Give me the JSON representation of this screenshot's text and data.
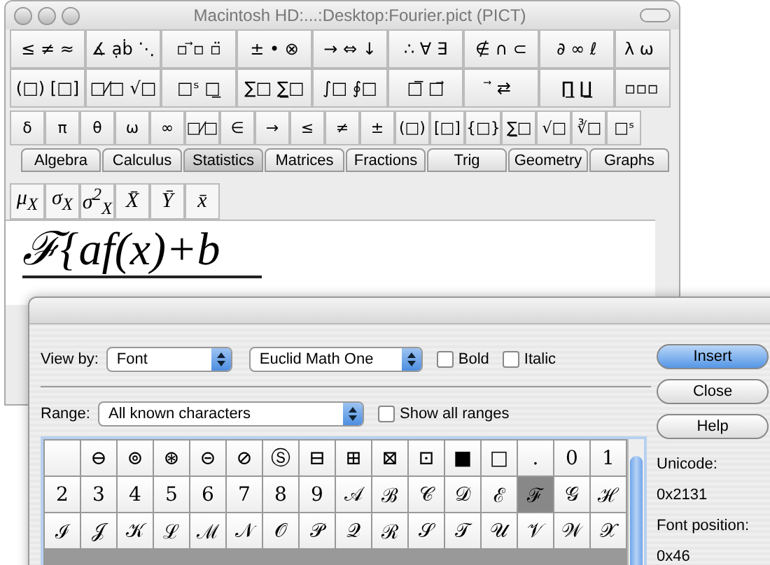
{
  "window": {
    "title": "Macintosh HD:...:Desktop:Fourier.pict (PICT)"
  },
  "palette": {
    "symbol_rows": [
      [
        "≤ ≠ ≈",
        "∡ ạḃ ⋱",
        "▫ ⃗▫ ▫̈",
        "± • ⊗",
        "→ ⇔ ↓",
        "∴ ∀ ∃",
        "∉ ∩ ⊂",
        "∂ ∞ ℓ",
        "λ ω"
      ],
      [
        "(□) [□]",
        "□⁄□ √□",
        "□ˢ □̲",
        "∑□ ∑̲□",
        "∫□ ∮□",
        "□̅ □⃗",
        "⃗ ⇄",
        "∏̲ ∐̲",
        "▫▫▫"
      ]
    ],
    "small_row": [
      "δ",
      "π",
      "θ",
      "ω",
      "∞",
      "□⁄□",
      "∈",
      "→",
      "≤",
      "≠",
      "±",
      "(□)",
      "[□]",
      "{□}",
      "∑̲□",
      "√□",
      "∛□",
      "□ˢ"
    ],
    "tabs": [
      {
        "label": "Algebra",
        "selected": false
      },
      {
        "label": "Calculus",
        "selected": false
      },
      {
        "label": "Statistics",
        "selected": true
      },
      {
        "label": "Matrices",
        "selected": false
      },
      {
        "label": "Fractions",
        "selected": false
      },
      {
        "label": "Trig",
        "selected": false
      },
      {
        "label": "Geometry",
        "selected": false
      },
      {
        "label": "Graphs",
        "selected": false
      }
    ],
    "tab_items": [
      "μ$_{X}$",
      "σ$_{X}$",
      "σ$^{2}$$_{X}$",
      "X̄",
      "Ȳ",
      "x̄"
    ]
  },
  "equation": "ℱ{af(x)+b",
  "dialog": {
    "view_by_label": "View by:",
    "view_by": "Font",
    "font": "Euclid Math One",
    "styles": [
      {
        "label": "Bold",
        "checked": false
      },
      {
        "label": "Italic",
        "checked": false
      }
    ],
    "range_label": "Range:",
    "range": "All known characters",
    "show_all_ranges": {
      "label": "Show all ranges",
      "checked": false
    },
    "buttons": [
      {
        "label": "Insert",
        "default": true
      },
      {
        "label": "Close",
        "default": false
      },
      {
        "label": "Help",
        "default": false
      }
    ],
    "characters": [
      [
        {
          "selected": false
        },
        {
          "char": "⊖",
          "selected": false
        },
        {
          "char": "⊚",
          "selected": false
        },
        {
          "char": "⊛",
          "selected": false
        },
        {
          "char": "⊝",
          "selected": false
        },
        {
          "char": "⊘",
          "selected": false
        },
        {
          "char": "Ⓢ",
          "selected": false
        },
        {
          "char": "⊟",
          "selected": false
        },
        {
          "char": "⊞",
          "selected": false
        },
        {
          "char": "⊠",
          "selected": false
        },
        {
          "char": "⊡",
          "selected": false
        },
        {
          "char": "■",
          "selected": false
        },
        {
          "char": "□",
          "selected": false
        },
        {
          "char": ".",
          "selected": false
        },
        {
          "char": "0",
          "selected": false
        },
        {
          "char": "1",
          "selected": false
        }
      ],
      [
        {
          "char": "2",
          "selected": false
        },
        {
          "char": "3",
          "selected": false
        },
        {
          "char": "4",
          "selected": false
        },
        {
          "char": "5",
          "selected": false
        },
        {
          "char": "6",
          "selected": false
        },
        {
          "char": "7",
          "selected": false
        },
        {
          "char": "8",
          "selected": false
        },
        {
          "char": "9",
          "selected": false
        },
        {
          "char": "𝒜",
          "selected": false
        },
        {
          "char": "ℬ",
          "selected": false
        },
        {
          "char": "𝒞",
          "selected": false
        },
        {
          "char": "𝒟",
          "selected": false
        },
        {
          "char": "ℰ",
          "selected": false
        },
        {
          "char": "ℱ",
          "selected": true
        },
        {
          "char": "𝒢",
          "selected": false
        },
        {
          "char": "ℋ",
          "selected": false
        }
      ],
      [
        {
          "char": "ℐ",
          "selected": false
        },
        {
          "char": "𝒥",
          "selected": false
        },
        {
          "char": "𝒦",
          "selected": false
        },
        {
          "char": "ℒ",
          "selected": false
        },
        {
          "char": "ℳ",
          "selected": false
        },
        {
          "char": "𝒩",
          "selected": false
        },
        {
          "char": "𝒪",
          "selected": false
        },
        {
          "char": "𝒫",
          "selected": false
        },
        {
          "char": "𝒬",
          "selected": false
        },
        {
          "char": "ℛ",
          "selected": false
        },
        {
          "char": "𝒮",
          "selected": false
        },
        {
          "char": "𝒯",
          "selected": false
        },
        {
          "char": "𝒰",
          "selected": false
        },
        {
          "char": "𝒱",
          "selected": false
        },
        {
          "char": "𝒲",
          "selected": false
        },
        {
          "char": "𝒳",
          "selected": false
        }
      ]
    ],
    "info": [
      "Unicode:",
      "0x2131",
      "Font position:",
      "0x46"
    ]
  }
}
